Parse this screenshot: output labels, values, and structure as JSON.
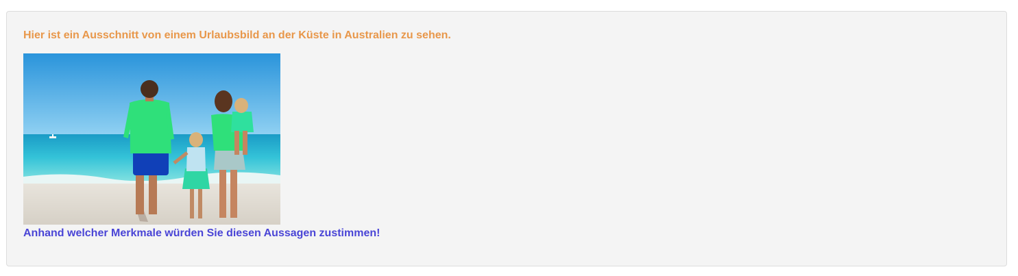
{
  "content": {
    "intro_text": "Hier ist ein Ausschnitt von einem Urlaubsbild an der Küste in Australien zu sehen.",
    "question_text": "Anhand welcher Merkmale würden Sie diesen Aussagen zustimmen!"
  },
  "colors": {
    "intro": "#e8974a",
    "question": "#4a45d6",
    "panel_background": "#f4f4f4",
    "panel_border": "#dcdcdc"
  }
}
